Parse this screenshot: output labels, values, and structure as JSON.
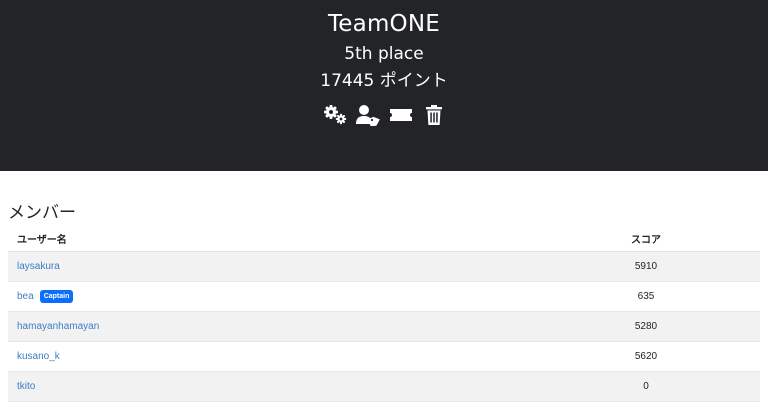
{
  "team": {
    "name": "TeamONE",
    "place": "5th place",
    "points": "17445 ポイント"
  },
  "actions": [
    {
      "icon": "settings-icon"
    },
    {
      "icon": "user-tag-icon"
    },
    {
      "icon": "ticket-icon"
    },
    {
      "icon": "trash-icon"
    }
  ],
  "members": {
    "title": "メンバー",
    "headers": {
      "username": "ユーザー名",
      "score": "スコア"
    },
    "rows": [
      {
        "username": "laysakura",
        "score": "5910",
        "badge": ""
      },
      {
        "username": "bea",
        "score": "635",
        "badge": "Captain"
      },
      {
        "username": "hamayanhamayan",
        "score": "5280",
        "badge": ""
      },
      {
        "username": "kusano_k",
        "score": "5620",
        "badge": ""
      },
      {
        "username": "tkito",
        "score": "0",
        "badge": ""
      }
    ]
  },
  "colors": {
    "header_bg": "#222428",
    "link": "#3d7cc8",
    "badge": "#0d6efd",
    "stripe": "#f2f2f2"
  }
}
